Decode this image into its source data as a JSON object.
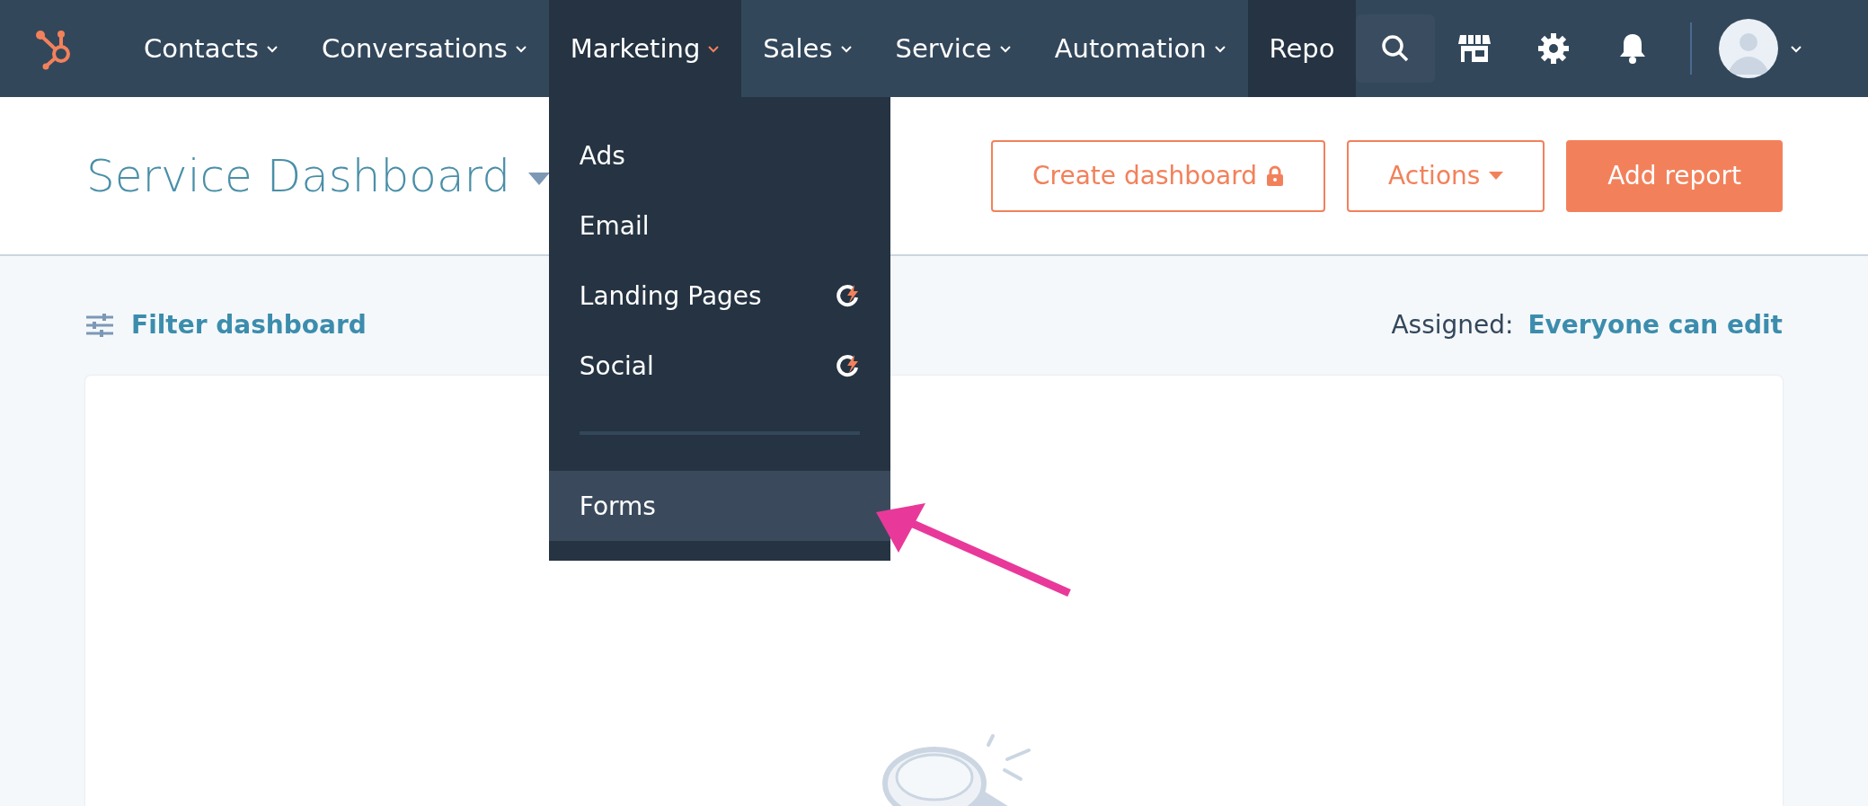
{
  "nav": {
    "items": [
      {
        "label": "Contacts",
        "selected": false,
        "caret": true,
        "hovered": false
      },
      {
        "label": "Conversations",
        "selected": false,
        "caret": true,
        "hovered": false
      },
      {
        "label": "Marketing",
        "selected": true,
        "caret": true,
        "hovered": false
      },
      {
        "label": "Sales",
        "selected": false,
        "caret": true,
        "hovered": false
      },
      {
        "label": "Service",
        "selected": false,
        "caret": true,
        "hovered": false
      },
      {
        "label": "Automation",
        "selected": false,
        "caret": true,
        "hovered": false
      },
      {
        "label": "Repo",
        "selected": false,
        "caret": false,
        "hovered": true
      }
    ]
  },
  "menu": {
    "items": [
      {
        "kind": "link",
        "label": "Ads",
        "beta": false,
        "selected": false
      },
      {
        "kind": "link",
        "label": "Email",
        "beta": false,
        "selected": false
      },
      {
        "kind": "link",
        "label": "Landing Pages",
        "beta": true,
        "selected": false
      },
      {
        "kind": "link",
        "label": "Social",
        "beta": true,
        "selected": false
      },
      {
        "kind": "separator"
      },
      {
        "kind": "link",
        "label": "Forms",
        "beta": false,
        "selected": true
      }
    ]
  },
  "header": {
    "title": "Service Dashboard",
    "buttons": [
      {
        "label": "Create dashboard",
        "kind": "locked"
      },
      {
        "label": "Actions",
        "kind": "dropdown"
      },
      {
        "label": "Add report",
        "kind": "primary"
      }
    ]
  },
  "filter": {
    "label": "Filter dashboard",
    "assigned_label": "Assigned:",
    "assigned_value": "Everyone can edit"
  }
}
